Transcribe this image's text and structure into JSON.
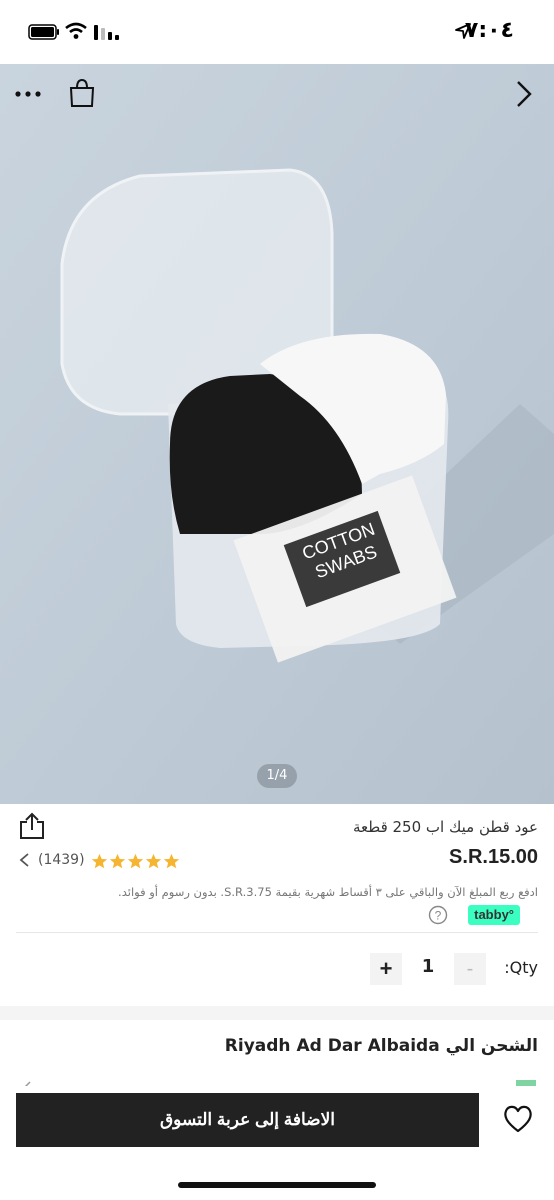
{
  "status_bar": {
    "time": "٧:٠٤",
    "icons": [
      "location-arrow-icon",
      "battery-icon",
      "wifi-icon",
      "signal-icon"
    ]
  },
  "gallery": {
    "page_indicator": "1/4",
    "icons": [
      "more-icon",
      "shopping-bag-icon",
      "chevron-right-icon"
    ],
    "photo_text": [
      "COTTON",
      "SWABS"
    ]
  },
  "product": {
    "title": "عود قطن ميك اب 250 قطعة",
    "price": "S.R.15.00",
    "rating_count": "(1439)",
    "rating_stars": 5,
    "star_color": "#f6b531",
    "installment_text": "ادفع ربع المبلغ الآن والباقي على ٣ أقساط شهرية بقيمة S.R.3.75. بدون رسوم أو فوائد.",
    "tabby_label": "tabby",
    "tabby_color": "#3bffc1"
  },
  "quantity": {
    "label": ":Qty",
    "value": "1",
    "minus_label": "-",
    "plus_label": "+"
  },
  "shipping": {
    "label": "الشحن الي Riyadh Ad Dar Albaida"
  },
  "bottom_bar": {
    "add_to_cart_label": "الاضافة إلى عربة التسوق",
    "button_color": "#222222"
  }
}
